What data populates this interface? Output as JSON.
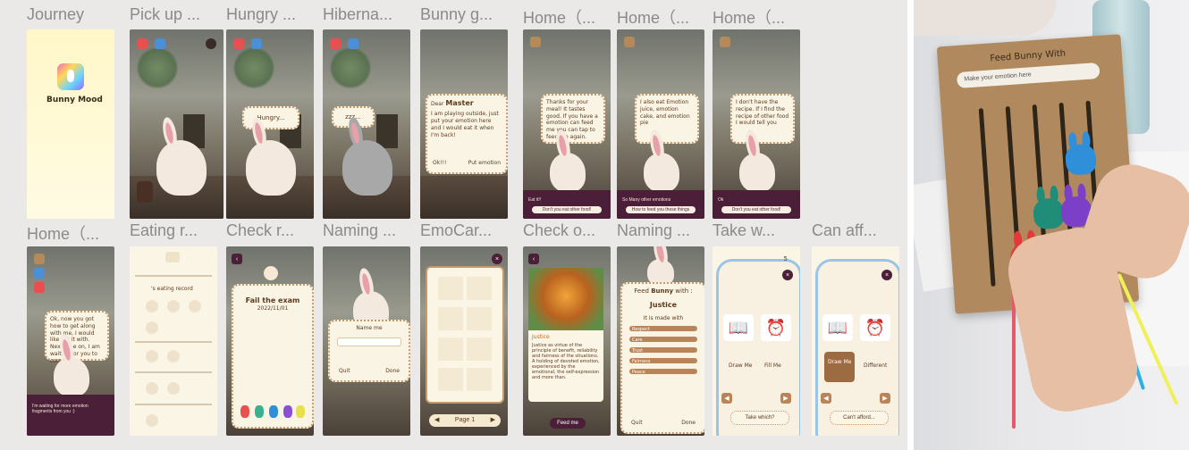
{
  "frames": [
    {
      "title": "Journey"
    },
    {
      "title": "Pick up ..."
    },
    {
      "title": "Hungry ..."
    },
    {
      "title": "Hiberna..."
    },
    {
      "title": "Bunny g..."
    },
    {
      "title": "Home（..."
    },
    {
      "title": "Home（..."
    },
    {
      "title": "Home（..."
    },
    {
      "title": "Home（..."
    },
    {
      "title": "Eating r..."
    },
    {
      "title": "Check r..."
    },
    {
      "title": "Naming ..."
    },
    {
      "title": "EmoCar..."
    },
    {
      "title": "Check o..."
    },
    {
      "title": "Naming ..."
    },
    {
      "title": "Take w..."
    },
    {
      "title": "Can aff..."
    }
  ],
  "screens": {
    "journey": {
      "app_name": "Bunny Mood"
    },
    "hungry": {
      "bubble": "Hungry..."
    },
    "hibernate": {
      "bubble": "zzz..."
    },
    "bunny_gone": {
      "salutation": "Dear",
      "name": "Master",
      "message": "I am playing outside, just put your emotion here and I would eat it when I'm back!",
      "left_button": "Ok!!!",
      "right_button": "Put emotion"
    },
    "home1": {
      "bubble": "Thanks for your meal! It tastes good. If you have a emotion can feed me you can tap to feed me again.",
      "note": "Eat it!!",
      "button": "Don't you eat other food!"
    },
    "home2": {
      "bubble": "I also eat Emotion juice, emotion cake, and emotion pie",
      "note": "So Many other emotions",
      "button": "How to feed you these things"
    },
    "home3": {
      "bubble": "I don't have the recipe. If I find the recipe of other food I would tell you",
      "note": "Ok",
      "button": "Don't you eat other food!"
    },
    "home4": {
      "bubble": "Ok, now you got how to get along with me, I would like eat it with. Next time on, I am waiting for you to come!",
      "note": "I'm waiting for more emotion fragments from you :)"
    },
    "eating": {
      "title": "'s eating record"
    },
    "check": {
      "title": "Fail the exam",
      "date": "2022/11/01"
    },
    "naming1": {
      "heading": "Name me",
      "left": "Quit",
      "right": "Done"
    },
    "emocard": {
      "page": "Page 1"
    },
    "checko": {
      "title": "Justice",
      "desc": "Justice as virtue of the principle of benefit, reliability and fairness of the situations. A holding of devoted emotion, experienced by the emotional, the self-expression and more than.",
      "button": "Feed me"
    },
    "naming2": {
      "prefix": "Feed",
      "name": "Bunny",
      "suffix": "with :",
      "emotion": "Justice",
      "made_with": "It is made with",
      "rows": [
        "Respect",
        "Care",
        "Trust",
        "Fairness",
        "Peace"
      ],
      "left": "Quit",
      "right": "Done"
    },
    "take": {
      "left_label": "Draw Me",
      "right_label": "Fill Me",
      "button": "Take which?",
      "count": "5"
    },
    "can": {
      "left_label": "Draw Me",
      "right_label": "Different",
      "button": "Can't afford..."
    }
  },
  "photo": {
    "board_title": "Feed Bunny With",
    "board_field": "Make your emotion here"
  }
}
